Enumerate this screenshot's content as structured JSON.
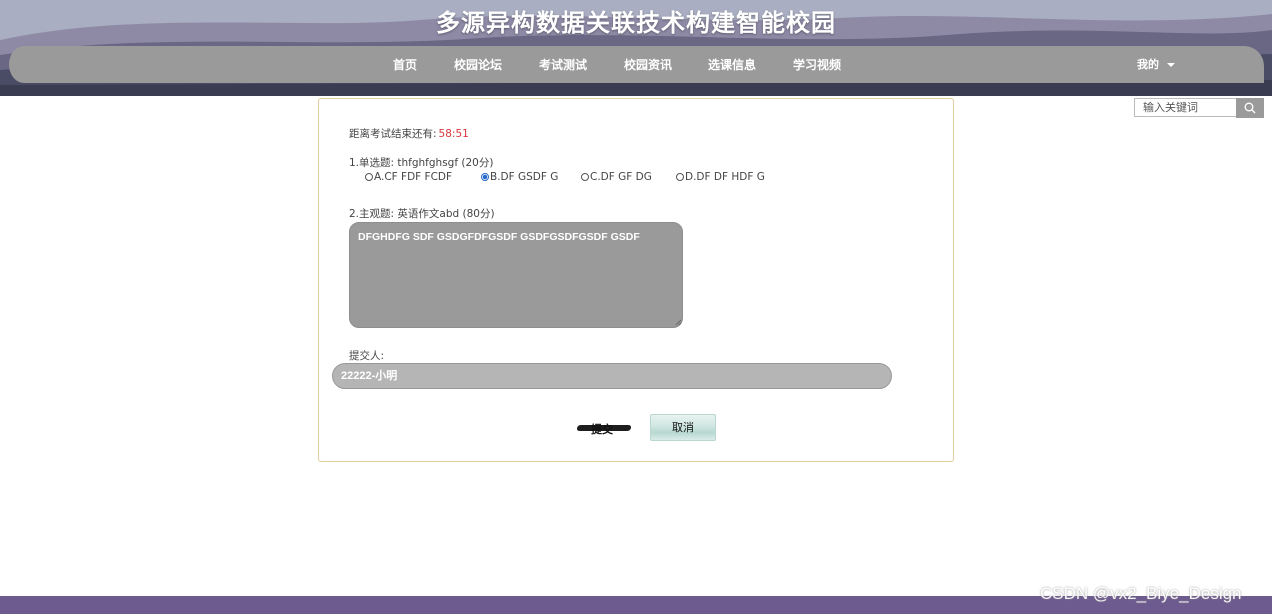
{
  "site": {
    "title": "多源异构数据关联技术构建智能校园"
  },
  "nav": {
    "items": [
      {
        "label": "首页"
      },
      {
        "label": "校园论坛"
      },
      {
        "label": "考试测试"
      },
      {
        "label": "校园资讯"
      },
      {
        "label": "选课信息"
      },
      {
        "label": "学习视频"
      }
    ],
    "user_label": "我的"
  },
  "search": {
    "placeholder": "输入关键词"
  },
  "exam": {
    "countdown_label": "距离考试结束还有:",
    "countdown_value": "58:51",
    "q1": {
      "title": "1.单选题: thfghfghsgf (20分)",
      "options": [
        {
          "label": "A.CF FDF FCDF",
          "checked": false
        },
        {
          "label": "B.DF GSDF G",
          "checked": true
        },
        {
          "label": "C.DF GF DG",
          "checked": false
        },
        {
          "label": "D.DF DF HDF G",
          "checked": false
        }
      ]
    },
    "q2": {
      "title": "2.主观题: 英语作文abd (80分)",
      "answer": "DFGHDFG SDF GSDGFDFGSDF GSDFGSDFGSDF GSDF"
    },
    "submitter_label": "提交人:",
    "submitter_value": "22222-小明",
    "submit_label": "提交",
    "cancel_label": "取消"
  },
  "watermark": "CSDN @vx2_Biye_Design",
  "colors": {
    "nav_bar": "#9a9a9a",
    "header_bg": "#3b3f56",
    "countdown": "#d9363e",
    "card_border": "#e4cd9e",
    "footer": "#6d5a8e"
  }
}
